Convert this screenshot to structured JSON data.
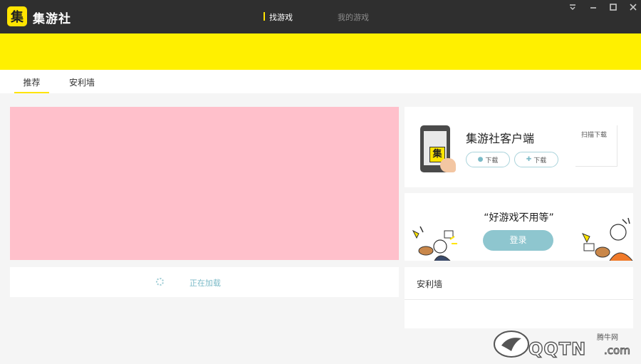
{
  "titlebar": {
    "logo_glyph": "集",
    "app_name": "集游社",
    "tabs": [
      {
        "label": "找游戏",
        "active": true
      },
      {
        "label": "我的游戏",
        "active": false
      }
    ],
    "window_buttons": [
      "menu-icon",
      "minimize-icon",
      "maximize-icon",
      "close-icon"
    ]
  },
  "subtabs": [
    {
      "label": "推荐",
      "active": true
    },
    {
      "label": "安利墙",
      "active": false
    }
  ],
  "main": {
    "loading_text": "正在加载"
  },
  "client_card": {
    "phone_logo": "集",
    "title": "集游社客户端",
    "ios_download": "下载",
    "android_download": "下载",
    "qr_label": "扫描下载"
  },
  "login_card": {
    "slogan": "“好游戏不用等”",
    "login_button": "登录"
  },
  "safe_card": {
    "title": "安利墙"
  },
  "watermark": {
    "cn_text": "腾牛网",
    "brand": "QQTN",
    "suffix": ".com"
  },
  "colors": {
    "titlebar_bg": "#2f2f2f",
    "accent_yellow": "#fff000",
    "carousel_placeholder": "#ffc0cb",
    "button_teal": "#8ec6cf"
  }
}
